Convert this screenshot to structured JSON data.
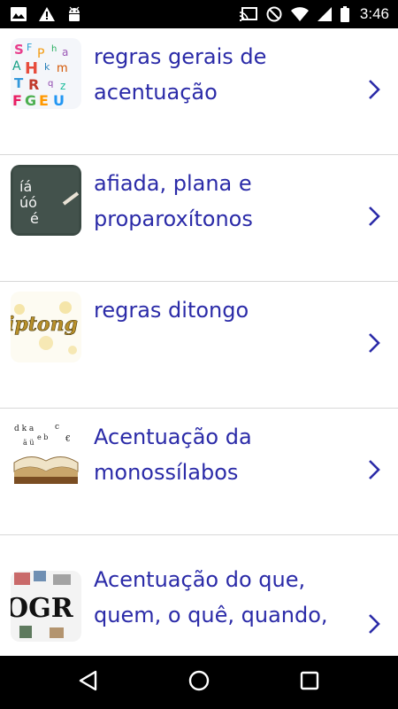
{
  "status_bar": {
    "time": "3:46",
    "left_icons": [
      "image-icon",
      "warning-icon",
      "android-icon"
    ],
    "right_icons": [
      "cast-icon",
      "do-not-disturb-icon",
      "wifi-icon",
      "signal-icon",
      "battery-icon"
    ]
  },
  "list": {
    "items": [
      {
        "title": "regras gerais de acentuação",
        "thumbnail": "letters-thumbnail"
      },
      {
        "title": "afiada, plana e proparoxítonos",
        "thumbnail": "chalkboard-thumbnail"
      },
      {
        "title": "regras ditongo",
        "thumbnail": "ditongo-thumbnail"
      },
      {
        "title": "Acentuação da monossílabos",
        "thumbnail": "book-thumbnail"
      },
      {
        "title": "Acentuação do que, quem, o quê, quando,",
        "thumbnail": "ogr-thumbnail"
      }
    ],
    "chalkboard_text": [
      "íá",
      "úó",
      "é"
    ],
    "ditongo_text": "iptong",
    "ogr_text": "OGR"
  },
  "nav_bar": {
    "buttons": [
      "back-icon",
      "home-icon",
      "recents-icon"
    ]
  },
  "colors": {
    "title": "#2b2ba8",
    "chevron": "#2b2ba8",
    "divider": "#d8d8d8",
    "system_bars": "#000000"
  }
}
